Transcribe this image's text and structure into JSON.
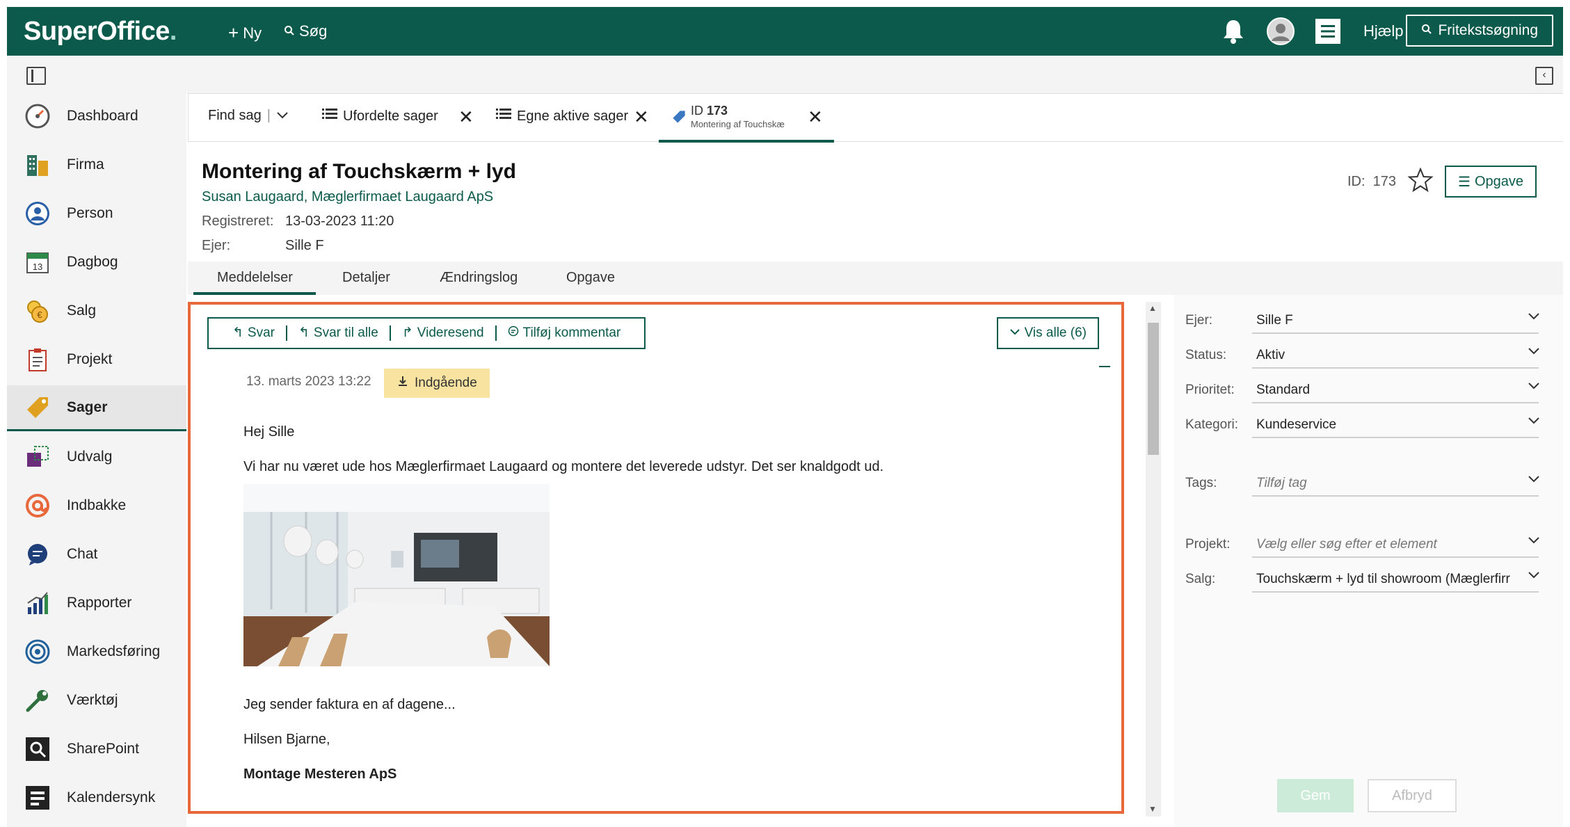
{
  "topbar": {
    "logo": "SuperOffice",
    "new_label": "Ny",
    "search_label": "Søg",
    "help_label": "Hjælp",
    "freetext_label": "Fritekstsøgning"
  },
  "sidebar": {
    "items": [
      {
        "label": "Dashboard",
        "icon": "dashboard-icon"
      },
      {
        "label": "Firma",
        "icon": "company-icon"
      },
      {
        "label": "Person",
        "icon": "person-icon"
      },
      {
        "label": "Dagbog",
        "icon": "calendar-icon"
      },
      {
        "label": "Salg",
        "icon": "sales-icon"
      },
      {
        "label": "Projekt",
        "icon": "project-icon"
      },
      {
        "label": "Sager",
        "icon": "ticket-icon"
      },
      {
        "label": "Udvalg",
        "icon": "selection-icon"
      },
      {
        "label": "Indbakke",
        "icon": "inbox-icon"
      },
      {
        "label": "Chat",
        "icon": "chat-icon"
      },
      {
        "label": "Rapporter",
        "icon": "reports-icon"
      },
      {
        "label": "Markedsføring",
        "icon": "marketing-icon"
      },
      {
        "label": "Værktøj",
        "icon": "tools-icon"
      },
      {
        "label": "SharePoint",
        "icon": "sharepoint-icon"
      },
      {
        "label": "Kalendersynk",
        "icon": "calendar-sync-icon"
      }
    ],
    "active_index": 6
  },
  "tabs": {
    "find": "Find sag",
    "unassigned": "Ufordelte sager",
    "own_active": "Egne aktive sager",
    "active_id_prefix": "ID",
    "active_id": "173",
    "active_subtitle": "Montering af Touchskæ"
  },
  "request": {
    "title": "Montering af Touchskærm + lyd",
    "contact": "Susan Laugaard, Mæglerfirmaet Laugaard ApS",
    "registered_label": "Registreret:",
    "registered_value": "13-03-2023 11:20",
    "owner_label": "Ejer:",
    "owner_value": "Sille F",
    "id_label": "ID:",
    "id_value": "173",
    "task_button": "Opgave"
  },
  "subtabs": [
    "Meddelelser",
    "Detaljer",
    "Ændringslog",
    "Opgave"
  ],
  "actions": {
    "reply": "Svar",
    "reply_all": "Svar til alle",
    "forward": "Videresend",
    "add_comment": "Tilføj kommentar",
    "show_all": "Vis alle (6)"
  },
  "message": {
    "date": "13. marts 2023 13:22",
    "badge": "Indgående",
    "greeting": "Hej Sille",
    "body": "Vi har nu været ude hos Mæglerfirmaet Laugaard og montere det leverede udstyr. Det ser knaldgodt ud.",
    "line2": "Jeg sender faktura en af dagene...",
    "signoff": "Hilsen Bjarne,",
    "company": "Montage Mesteren ApS"
  },
  "details": {
    "owner": {
      "label": "Ejer:",
      "value": "Sille F"
    },
    "status": {
      "label": "Status:",
      "value": "Aktiv"
    },
    "priority": {
      "label": "Prioritet:",
      "value": "Standard"
    },
    "category": {
      "label": "Kategori:",
      "value": "Kundeservice"
    },
    "tags": {
      "label": "Tags:",
      "placeholder": "Tilføj tag"
    },
    "project": {
      "label": "Projekt:",
      "placeholder": "Vælg eller søg efter et element"
    },
    "sale": {
      "label": "Salg:",
      "value": "Touchskærm + lyd til showroom (Mæglerfirr"
    },
    "save": "Gem",
    "cancel": "Afbryd"
  },
  "colors": {
    "brand": "#0b5a4b",
    "highlight": "#e8683c",
    "badge": "#f8e3a0"
  }
}
